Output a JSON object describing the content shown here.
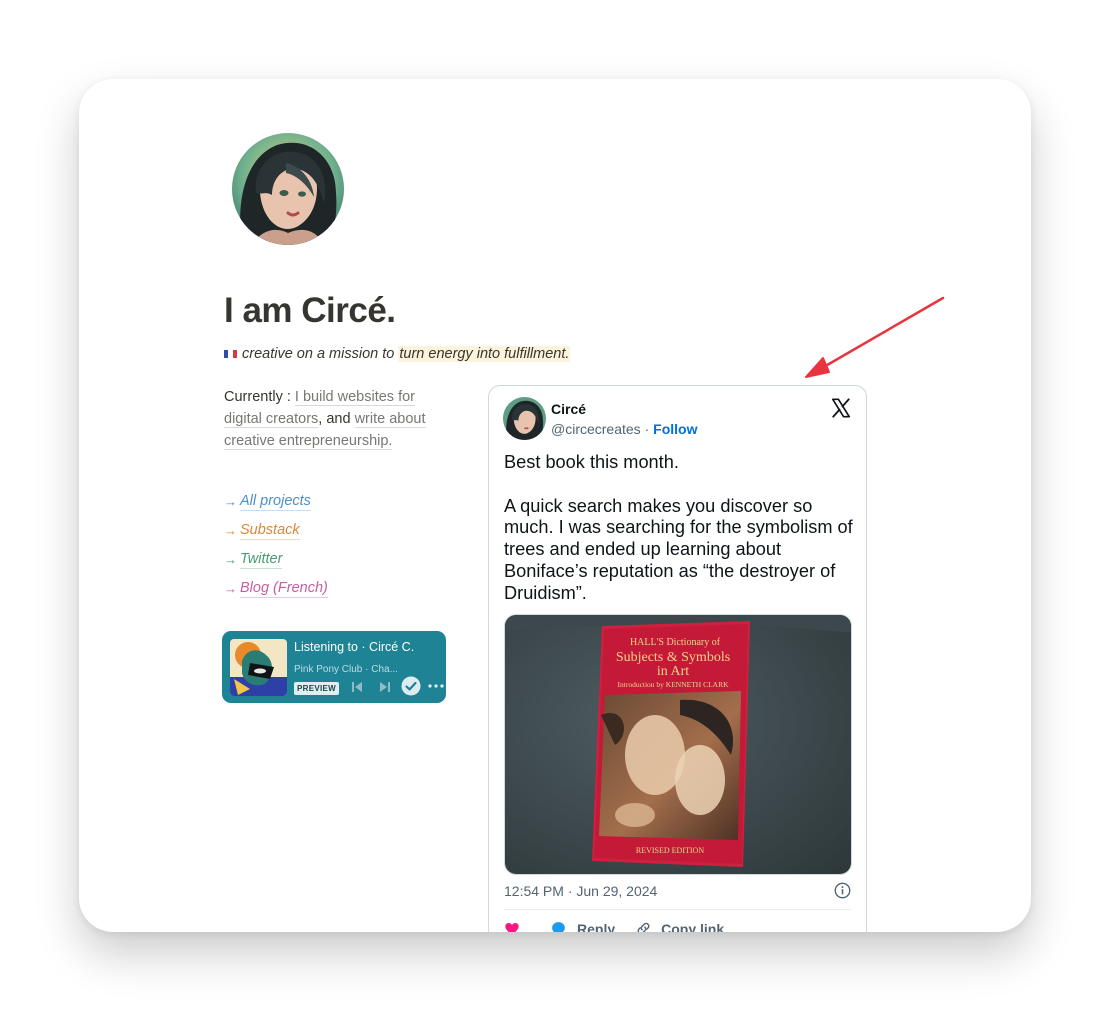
{
  "profile": {
    "title": "I am Circé.",
    "tagline_prefix": "creative on a mission to",
    "tagline_highlight": "turn energy into fulfillment."
  },
  "currently": {
    "label": "Currently :",
    "link1": "I build websites for digital creators",
    "middle": ", and",
    "link2": "write about creative entrepreneurship."
  },
  "links": [
    {
      "arrow": "→",
      "label": "All projects",
      "color": "#4d8fc4"
    },
    {
      "arrow": "→",
      "label": "Substack",
      "color": "#d9893a"
    },
    {
      "arrow": "→",
      "label": "Twitter",
      "color": "#4a9b74"
    },
    {
      "arrow": "→",
      "label": "Blog (French)",
      "color": "#c95ea0"
    }
  ],
  "spotify": {
    "title": "Listening to · Circé C.",
    "subtitle": "Pink Pony Club · Cha...",
    "preview_label": "PREVIEW"
  },
  "tweet": {
    "name": "Circé",
    "handle": "@circecreates",
    "separator": "·",
    "follow_label": "Follow",
    "text_line1": "Best book this month.",
    "text_body": "A quick search makes you discover so much. I was searching for the symbolism of trees and ended up learning about Boniface’s reputation as “the destroyer of Druidism”.",
    "timestamp": "12:54 PM · Jun 29, 2024",
    "reply_label": "Reply",
    "copy_label": "Copy link"
  },
  "book": {
    "line1": "HALL'S Dictionary of",
    "line2": "Subjects & Symbols",
    "line3": "in Art",
    "line4": "Introduction by KENNETH CLARK",
    "edition": "REVISED EDITION"
  },
  "colors": {
    "accent_arrow": "#e8343f",
    "spotify_bg": "#1f8396",
    "follow_blue": "#006fd6",
    "like_pink": "#f91880",
    "reply_blue": "#1d9bf0",
    "highlight": "#fbf3db"
  }
}
